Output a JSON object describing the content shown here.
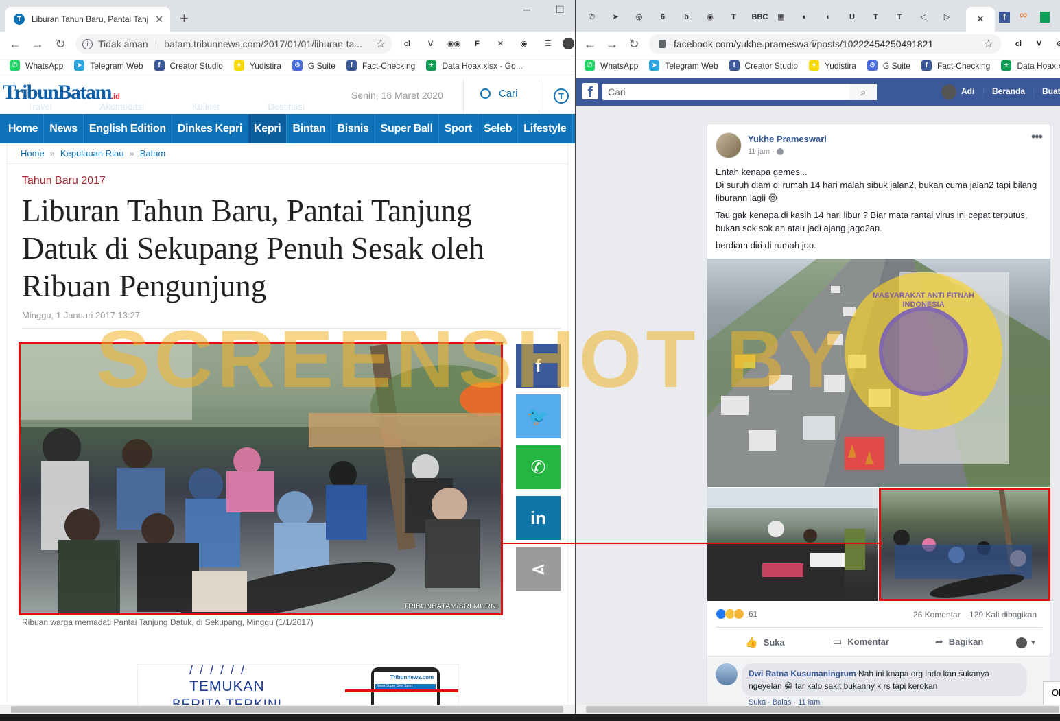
{
  "left_browser": {
    "tab_title": "Liburan Tahun Baru, Pantai Tanjung",
    "security_label": "Tidak aman",
    "url": "batam.tribunnews.com/2017/01/01/liburan-ta...",
    "bookmarks": [
      {
        "label": "WhatsApp",
        "color": "#25d366",
        "glyph": "✆"
      },
      {
        "label": "Telegram Web",
        "color": "#2ca5e0",
        "glyph": "➤"
      },
      {
        "label": "Creator Studio",
        "color": "#3b5998",
        "glyph": "f"
      },
      {
        "label": "Yudistira",
        "color": "#f7d800",
        "glyph": "✦"
      },
      {
        "label": "G Suite",
        "color": "#4a6ee0",
        "glyph": "⚙"
      },
      {
        "label": "Fact-Checking",
        "color": "#3b5998",
        "glyph": "f"
      },
      {
        "label": "Data Hoax.xlsx - Go...",
        "color": "#0f9d58",
        "glyph": "+"
      }
    ],
    "extensions": [
      "cl",
      "V",
      "◉◉",
      "F",
      "✕",
      "◉"
    ]
  },
  "tribun": {
    "logo_main": "TribunBatam",
    "logo_suffix": ".id",
    "logo_letter": "T",
    "date": "Senin, 16 Maret 2020",
    "search_label": "Cari",
    "faded_menu": [
      "Travel",
      "Akomodasi",
      "Kuliner",
      "Destinasi"
    ],
    "nav": [
      "Home",
      "News",
      "English Edition",
      "Dinkes Kepri",
      "Kepri",
      "Bintan",
      "Bisnis",
      "Super Ball",
      "Sport",
      "Seleb",
      "Lifestyle"
    ],
    "breadcrumb": [
      "Home",
      "Kepulauan Riau",
      "Batam"
    ],
    "breadcrumb_sep": "»",
    "category": "Tahun Baru 2017",
    "headline": "Liburan Tahun Baru, Pantai Tanjung Datuk di Sekupang Penuh Sesak oleh Ribuan Pengunjung",
    "datetime": "Minggu, 1 Januari 2017 13:27",
    "photo_credit": "TRIBUNBATAM/SRI MURNI",
    "caption": "Ribuan warga memadati Pantai Tanjung Datuk, di Sekupang, Minggu (1/1/2017)",
    "share_icons": [
      {
        "name": "facebook",
        "glyph": "f",
        "color": "#3b5998"
      },
      {
        "name": "twitter",
        "glyph": "🐦",
        "color": "#55acee"
      },
      {
        "name": "whatsapp",
        "glyph": "✆",
        "color": "#25b541"
      },
      {
        "name": "linkedin",
        "glyph": "in",
        "color": "#0e76a8"
      },
      {
        "name": "share",
        "glyph": "⋖",
        "color": "#9b9b9b"
      }
    ],
    "promo_line1": "TEMUKAN",
    "promo_line2": "BERITA TERKINI",
    "phone_logo": "Tribunnews.com",
    "phone_tabs": "News   Super Skor   Sport"
  },
  "right_browser": {
    "url": "facebook.com/yukhe.prameswari/posts/10222454250491821",
    "bookmarks": [
      {
        "label": "WhatsApp",
        "color": "#25d366",
        "glyph": "✆"
      },
      {
        "label": "Telegram Web",
        "color": "#2ca5e0",
        "glyph": "➤"
      },
      {
        "label": "Creator Studio",
        "color": "#3b5998",
        "glyph": "f"
      },
      {
        "label": "Yudistira",
        "color": "#f7d800",
        "glyph": "✦"
      },
      {
        "label": "G Suite",
        "color": "#4a6ee0",
        "glyph": "⚙"
      },
      {
        "label": "Fact-Checking",
        "color": "#3b5998",
        "glyph": "f"
      },
      {
        "label": "Data Hoax.xlsx",
        "color": "#0f9d58",
        "glyph": "+"
      }
    ],
    "tab_icons": [
      "✆",
      "➤",
      "◎",
      "6",
      "b",
      "◉",
      "T",
      "BBC",
      "▦",
      "◐",
      "◐",
      "U",
      "T",
      "T",
      "◁",
      "▷"
    ],
    "extensions": [
      "cl",
      "V",
      "⊘"
    ]
  },
  "facebook": {
    "search_placeholder": "Cari",
    "user_name": "Adi",
    "nav_home": "Beranda",
    "nav_create": "Buat",
    "poster_name": "Yukhe Prameswari",
    "post_time": "11 jam · ",
    "post_paragraphs": [
      "Entah kenapa gemes...\nDi suruh diam di rumah 14 hari malah sibuk jalan2, bukan cuma jalan2 tapi bilang liburann lagii 😔",
      "Tau gak kenapa di kasih 14 hari libur ? Biar mata rantai virus ini cepat terputus, bukan sok sok an atau jadi ajang jago2an.",
      "berdiam diri di rumah joo."
    ],
    "reactions_count": "61",
    "comments_count": "26 Komentar",
    "shares_count": "129 Kali dibagikan",
    "action_like": "Suka",
    "action_comment": "Komentar",
    "action_share": "Bagikan",
    "commenter_name": "Dwi Ratna Kusumaningrum",
    "comment_text": "Nah ini knapa org indo kan sukanya ngeyelan 😁 tar kalo sakit bukanny k rs tapi kerokan",
    "comment_actions": "Suka · Balas · 11 jam",
    "seal_text": "MASYARAKAT ANTI FITNAH INDONESIA"
  },
  "watermark": "SCREENSHOT BY"
}
